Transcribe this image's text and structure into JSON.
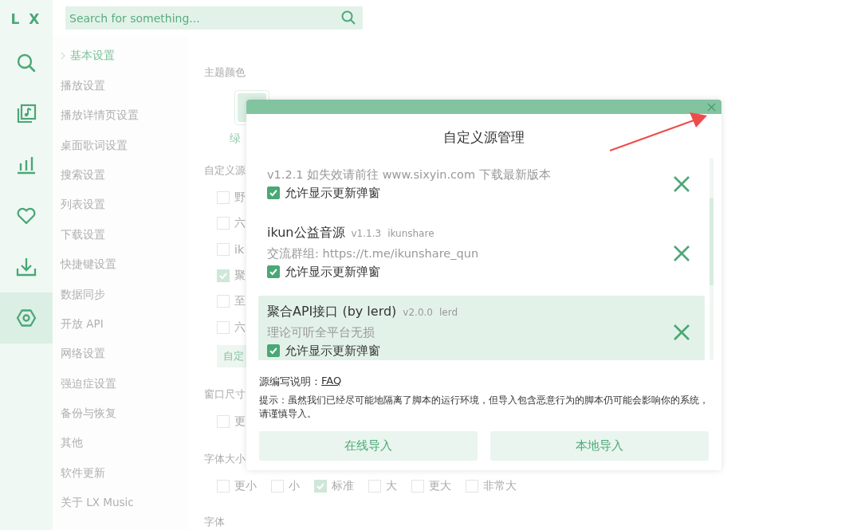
{
  "app": {
    "logo": "L X"
  },
  "nav_icons": [
    {
      "kind": "search",
      "selected": false
    },
    {
      "kind": "music",
      "selected": false
    },
    {
      "kind": "chart",
      "selected": false
    },
    {
      "kind": "heart",
      "selected": false
    },
    {
      "kind": "download",
      "selected": false
    },
    {
      "kind": "settings",
      "selected": true
    }
  ],
  "search": {
    "placeholder": "Search for something..."
  },
  "settings_nav": [
    {
      "label": "基本设置",
      "selected": true
    },
    {
      "label": "播放设置",
      "selected": false
    },
    {
      "label": "播放详情页设置",
      "selected": false
    },
    {
      "label": "桌面歌词设置",
      "selected": false
    },
    {
      "label": "搜索设置",
      "selected": false
    },
    {
      "label": "列表设置",
      "selected": false
    },
    {
      "label": "下载设置",
      "selected": false
    },
    {
      "label": "快捷键设置",
      "selected": false
    },
    {
      "label": "数据同步",
      "selected": false
    },
    {
      "label": "开放 API",
      "selected": false
    },
    {
      "label": "网络设置",
      "selected": false
    },
    {
      "label": "强迫症设置",
      "selected": false
    },
    {
      "label": "备份与恢复",
      "selected": false
    },
    {
      "label": "其他",
      "selected": false
    },
    {
      "label": "软件更新",
      "selected": false
    },
    {
      "label": "关于 LX Music",
      "selected": false
    }
  ],
  "settings": {
    "theme_label": "主题颜色",
    "theme_swatch_label": "绿",
    "custom_source_label": "自定义源",
    "custom_sources": [
      {
        "label": "野",
        "checked": false
      },
      {
        "label": "六",
        "checked": false
      },
      {
        "label": "ik",
        "checked": false
      },
      {
        "label": "聚",
        "checked": true
      },
      {
        "label": "至",
        "checked": false
      },
      {
        "label": "六",
        "checked": false
      }
    ],
    "custom_source_button": "自定",
    "window_size_label": "窗口尺寸",
    "window_sizes": [
      {
        "label": "更",
        "checked": false
      }
    ],
    "font_size_label": "字体大小",
    "font_sizes": [
      {
        "label": "更小",
        "checked": false
      },
      {
        "label": "小",
        "checked": false
      },
      {
        "label": "标准",
        "checked": true
      },
      {
        "label": "大",
        "checked": false
      },
      {
        "label": "更大",
        "checked": false
      },
      {
        "label": "非常大",
        "checked": false
      }
    ],
    "font_label": "字体"
  },
  "dialog": {
    "title": "自定义源管理",
    "sources": [
      {
        "description": "v1.2.1 如失效请前往 www.sixyin.com 下载最新版本",
        "update_label": "允许显示更新弹窗",
        "allow_update": true,
        "selected": false
      },
      {
        "name": "ikun公益音源",
        "version": "v1.1.3",
        "author": "ikunshare",
        "description": "交流群组: https://t.me/ikunshare_qun",
        "update_label": "允许显示更新弹窗",
        "allow_update": true,
        "selected": false
      },
      {
        "name": "聚合API接口 (by lerd)",
        "version": "v2.0.0",
        "author": "lerd",
        "description": "理论可听全平台无损",
        "update_label": "允许显示更新弹窗",
        "allow_update": true,
        "selected": true
      }
    ],
    "doc_label": "源编写说明：",
    "doc_link": "FAQ",
    "hint": "提示：虽然我们已经尽可能地隔离了脚本的运行环境，但导入包含恶意行为的脚本仍可能会影响你的系统，请谨慎导入。",
    "buttons": [
      "在线导入",
      "本地导入"
    ]
  }
}
